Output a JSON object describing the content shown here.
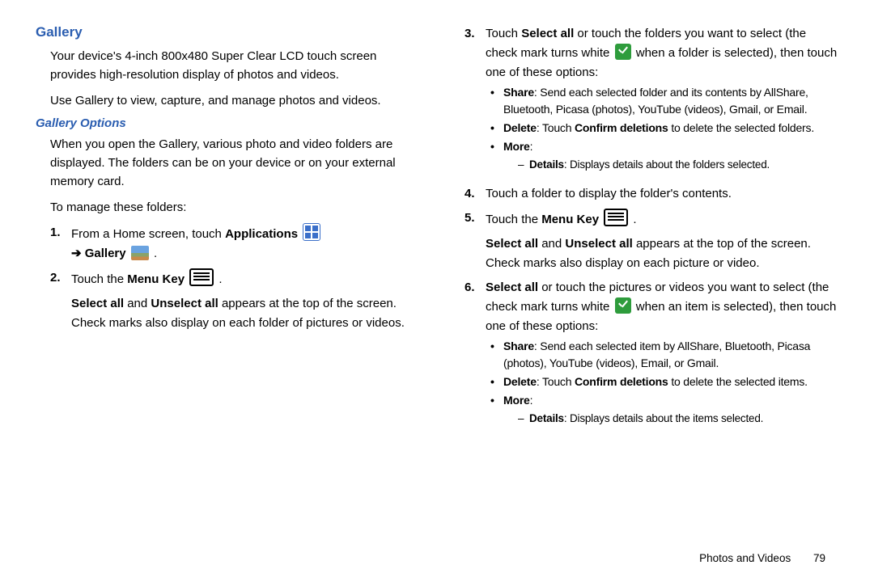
{
  "heading": "Gallery",
  "intro1": "Your device's 4-inch 800x480 Super Clear LCD touch screen provides high-resolution display of photos and videos.",
  "intro2": "Use Gallery to view, capture, and manage photos and videos.",
  "sub_heading": "Gallery Options",
  "go_intro": "When you open the Gallery, various photo and video folders are displayed. The folders can be on your device or on your external memory card.",
  "go_lead": "To manage these folders:",
  "step1_a": "From a Home screen, touch ",
  "step1_apps": "Applications",
  "step1_arrow": "➔ ",
  "step1_gallery": "Gallery",
  "period": " .",
  "step2_a": "Touch the ",
  "step2_menu": "Menu Key",
  "step2_body_a": "Select all",
  "step2_body_mid": " and ",
  "step2_body_b": "Unselect all",
  "step2_body_end": " appears at the top of the screen. Check marks also display on each folder of pictures or videos.",
  "step3_a": "Touch ",
  "step3_sel": "Select all",
  "step3_mid": " or touch the folders you want to select (the check mark turns white ",
  "step3_end": " when a folder is selected), then touch one of these options:",
  "b_share": "Share",
  "b_share_txt": ": Send each selected folder and its contents by AllShare, Bluetooth, Picasa (photos), YouTube (videos), Gmail, or Email.",
  "b_delete": "Delete",
  "b_delete_mid": ": Touch ",
  "b_delete_conf": "Confirm deletions",
  "b_delete_end": " to delete the selected folders.",
  "b_more": "More",
  "colon": ":",
  "d_details": "Details",
  "d_details_txt": ": Displays details about the folders selected.",
  "step4": "Touch a folder to display the folder's contents.",
  "step5_a": "Touch the ",
  "step5_menu": "Menu Key",
  "step5_body_a": "Select all",
  "step5_body_b": "Unselect all",
  "step5_body_end": " appears at the top of the screen. Check marks also display on each picture or video.",
  "step6_sel": "Select all",
  "step6_mid": " or touch the pictures or videos you want to select (the check mark turns white ",
  "step6_end": " when an item is selected), then touch one of these options:",
  "b6_share_txt": ": Send each selected item by AllShare, Bluetooth, Picasa (photos), YouTube (videos), Email, or Gmail.",
  "b6_delete_end": " to delete the selected items.",
  "d6_details_txt": ": Displays details about the items selected.",
  "footer_section": "Photos and Videos",
  "footer_page": "79"
}
